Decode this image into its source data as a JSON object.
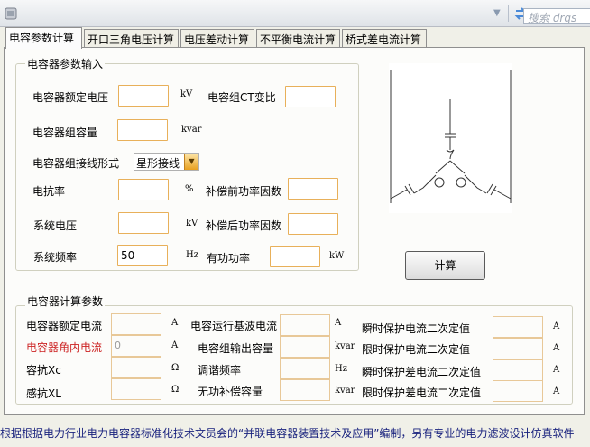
{
  "topbar": {
    "search_placeholder": "搜索 drqs"
  },
  "tabs": [
    {
      "label": "电容参数计算",
      "active": true
    },
    {
      "label": "开口三角电压计算",
      "active": false
    },
    {
      "label": "电压差动计算",
      "active": false
    },
    {
      "label": "不平衡电流计算",
      "active": false
    },
    {
      "label": "桥式差电流计算",
      "active": false
    }
  ],
  "input_group": {
    "title": "电容器参数输入",
    "rated_voltage": {
      "label": "电容器额定电压",
      "unit": "kV",
      "value": ""
    },
    "ct_ratio": {
      "label": "电容组CT变比",
      "value": ""
    },
    "capacity": {
      "label": "电容器组容量",
      "unit": "kvar",
      "value": ""
    },
    "wiring": {
      "label": "电容器组接线形式",
      "value": "星形接线"
    },
    "reactance_rate": {
      "label": "电抗率",
      "unit": "%",
      "value": ""
    },
    "pf_before": {
      "label": "补偿前功率因数",
      "value": ""
    },
    "system_voltage": {
      "label": "系统电压",
      "unit": "kV",
      "value": ""
    },
    "pf_after": {
      "label": "补偿后功率因数",
      "value": ""
    },
    "system_freq": {
      "label": "系统频率",
      "unit": "Hz",
      "value": "50"
    },
    "active_power": {
      "label": "有功功率",
      "unit": "kW",
      "value": ""
    }
  },
  "calc_button": "计算",
  "result_group": {
    "title": "电容器计算参数",
    "rated_current": {
      "label": "电容器额定电流",
      "unit": "A",
      "value": ""
    },
    "inner_current": {
      "label": "电容器角内电流",
      "unit": "A",
      "value": "0"
    },
    "reactance": {
      "label": "容抗Xc",
      "unit": "Ω",
      "value": ""
    },
    "inductive": {
      "label": "感抗XL",
      "unit": "Ω",
      "value": ""
    },
    "fundamental": {
      "label": "电容运行基波电流",
      "unit": "A",
      "value": ""
    },
    "output_capacity": {
      "label": "电容组输出容量",
      "unit": "kvar",
      "value": ""
    },
    "tuning_freq": {
      "label": "调谐频率",
      "unit": "Hz",
      "value": ""
    },
    "reactive_comp": {
      "label": "无功补偿容量",
      "unit": "kvar",
      "value": ""
    },
    "inst_current": {
      "label": "瞬时保护电流二次定值",
      "unit": "A",
      "value": ""
    },
    "time_current": {
      "label": "限时保护电流二次定值",
      "unit": "A",
      "value": ""
    },
    "inst_diff": {
      "label": "瞬时保护差电流二次定值",
      "unit": "A",
      "value": ""
    },
    "time_diff": {
      "label": "限时保护差电流二次定值",
      "unit": "A",
      "value": ""
    }
  },
  "status_marquee": "根据根据电力行业电力电容器标准化技术文员会的“并联电容器装置技术及应用”编制，另有专业的电力滤波设计仿真软件",
  "colors": {
    "input_border": "#e8b05a",
    "warning_label": "#cc2222",
    "marquee_text": "#1a237e"
  },
  "icons": [
    "app-icon",
    "chevron-down-icon",
    "refresh-icon"
  ]
}
